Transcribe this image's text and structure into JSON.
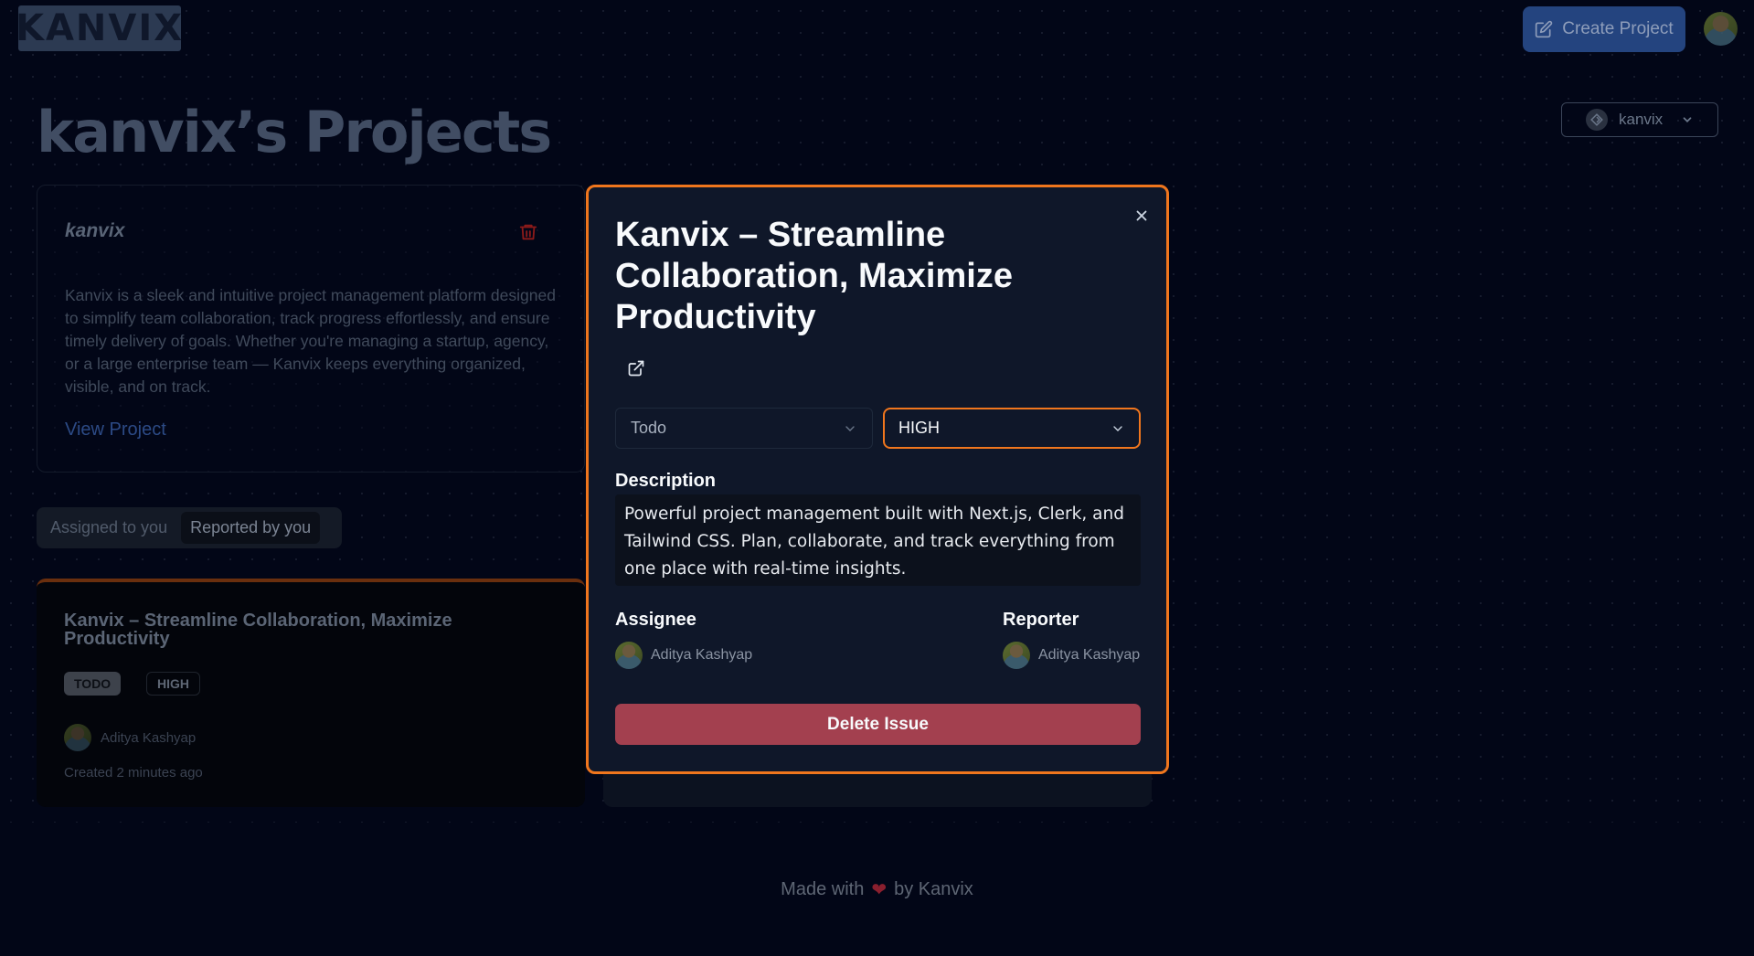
{
  "header": {
    "logo_text": "KANVIX",
    "create_project_label": "Create Project",
    "create_icon": "edit-square-icon",
    "avatar_icon": "user-avatar"
  },
  "page": {
    "title": "kanvix’s Projects"
  },
  "org_selector": {
    "selected": "kanvix",
    "icon": "org-logo-icon"
  },
  "project_card": {
    "name": "kanvix",
    "description": "Kanvix is a sleek and intuitive project management platform designed to simplify team collaboration, track progress effortlessly, and ensure timely delivery of goals. Whether you're managing a startup, agency, or a large enterprise team — Kanvix keeps everything organized, visible, and on track.",
    "view_link": "View Project",
    "delete_icon": "trash-icon"
  },
  "tabs": [
    {
      "label": "Assigned to you",
      "active": false
    },
    {
      "label": "Reported by you",
      "active": true
    }
  ],
  "issue_card": {
    "title": "Kanvix – Streamline Collaboration, Maximize Productivity",
    "status": "TODO",
    "priority": "HIGH",
    "assignee": "Aditya Kashyap",
    "created": "Created 2 minutes ago"
  },
  "footer": {
    "prefix": "Made with",
    "heart": "❤",
    "suffix": "by Kanvix"
  },
  "modal": {
    "title": "Kanvix – Streamline Collaboration, Maximize Productivity",
    "status_value": "Todo",
    "priority_value": "HIGH",
    "description_label": "Description",
    "description": "Powerful project management built with Next.js, Clerk, and Tailwind CSS. Plan, collaborate, and track everything from one place with real-time insights.",
    "assignee_label": "Assignee",
    "assignee_name": "Aditya Kashyap",
    "reporter_label": "Reporter",
    "reporter_name": "Aditya Kashyap",
    "delete_label": "Delete Issue"
  },
  "colors": {
    "background": "#020617",
    "modal_bg": "#0f1729",
    "accent_orange": "#f0761d",
    "danger": "#a3404f",
    "primary_blue": "#24447f"
  }
}
